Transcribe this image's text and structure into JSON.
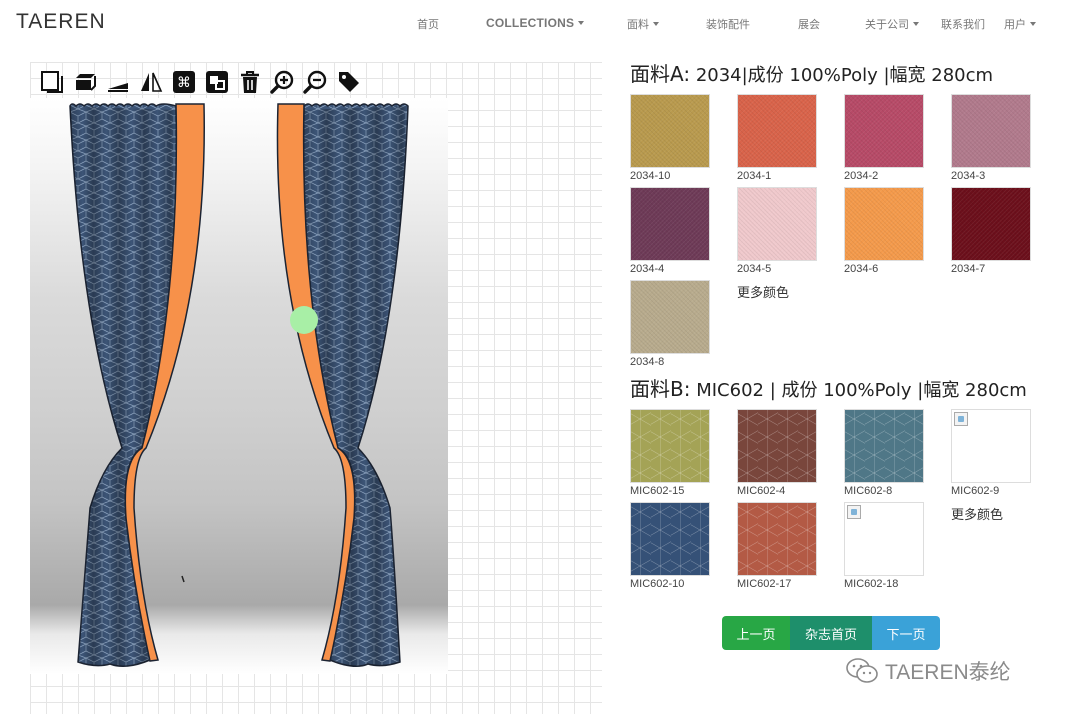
{
  "header": {
    "brand": "TAEREN",
    "nav": [
      {
        "label": "首页"
      },
      {
        "label": "COLLECTIONS"
      },
      {
        "label": "面料"
      },
      {
        "label": "装饰配件"
      },
      {
        "label": "展会"
      },
      {
        "label": "关于公司"
      },
      {
        "label": "联系我们"
      },
      {
        "label": "用户"
      }
    ]
  },
  "toolbar": {
    "tools": [
      "layer-front-icon",
      "layer-back-icon",
      "flip-horizontal-icon",
      "mirror-icon",
      "group-icon",
      "ungroup-icon",
      "trash-icon",
      "zoom-in-icon",
      "zoom-out-icon",
      "tag-icon"
    ]
  },
  "fabric_a": {
    "label": "面料A:",
    "spec": "2034|成份 100%Poly |幅宽 280cm",
    "swatches": [
      {
        "code": "2034-10",
        "color": "#b99a4e"
      },
      {
        "code": "2034-1",
        "color": "#d9634a"
      },
      {
        "code": "2034-2",
        "color": "#b74a67"
      },
      {
        "code": "2034-3",
        "color": "#b17a8c"
      },
      {
        "code": "2034-4",
        "color": "#6e3a57"
      },
      {
        "code": "2034-5",
        "color": "#f0c9cc"
      },
      {
        "code": "2034-6",
        "color": "#f49a4b"
      },
      {
        "code": "2034-7",
        "color": "#6c0f1b"
      },
      {
        "code": "2034-8",
        "color": "#b8ab8d"
      }
    ],
    "more": "更多颜色"
  },
  "fabric_b": {
    "label": "面料B:",
    "spec": "MIC602 | 成份 100%Poly |幅宽 280cm",
    "swatches": [
      {
        "code": "MIC602-15",
        "color": "#a4a356",
        "pattern": true
      },
      {
        "code": "MIC602-4",
        "color": "#79463c",
        "pattern": true
      },
      {
        "code": "MIC602-8",
        "color": "#4f7787",
        "pattern": true
      },
      {
        "code": "MIC602-9",
        "broken": true
      },
      {
        "code": "MIC602-10",
        "color": "#355177",
        "pattern": true
      },
      {
        "code": "MIC602-17",
        "color": "#b35a45",
        "pattern": true
      },
      {
        "code": "MIC602-18",
        "broken": true
      }
    ],
    "more": "更多颜色"
  },
  "pager": {
    "prev": "上一页",
    "home": "杂志首页",
    "next": "下一页"
  },
  "watermark": "TAEREN泰纶",
  "colors": {
    "curtain_main": "#3c5476",
    "curtain_lining": "#f7914a",
    "handle": "#a8efa6"
  }
}
